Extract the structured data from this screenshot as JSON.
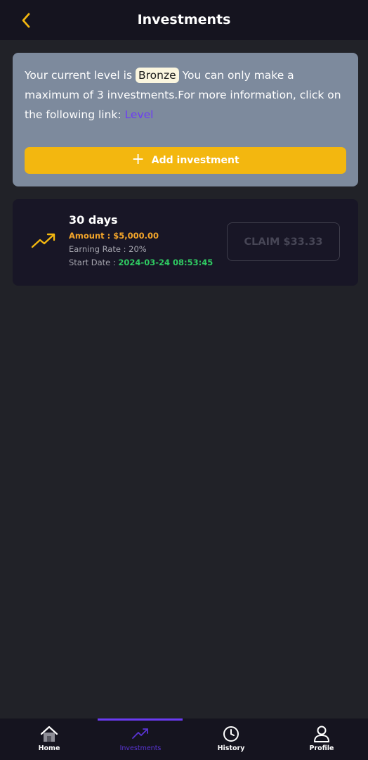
{
  "header": {
    "title": "Investments"
  },
  "info": {
    "text_before": "Your current level is",
    "level": "Bronze",
    "text_after": "You can only make a maximum of 3 investments.For more information, click on the following link:",
    "link_label": "Level",
    "add_button_label": "Add investment"
  },
  "investment": {
    "title": "30 days",
    "amount": "Amount : $5,000.00",
    "earning_rate": "Earning Rate : 20%",
    "start_date_label": "Start Date :",
    "start_date_value": "2024-03-24 08:53:45",
    "claim_label": "CLAIM $33.33"
  },
  "nav": {
    "items": [
      {
        "label": "Home",
        "icon": "home-icon"
      },
      {
        "label": "Investments",
        "icon": "trend-icon",
        "active": true
      },
      {
        "label": "History",
        "icon": "clock-icon"
      },
      {
        "label": "Profile",
        "icon": "user-icon"
      }
    ]
  },
  "colors": {
    "accent": "#f3b70f",
    "primary": "#6a3af2",
    "success": "#2fca62",
    "background": "#212228"
  }
}
